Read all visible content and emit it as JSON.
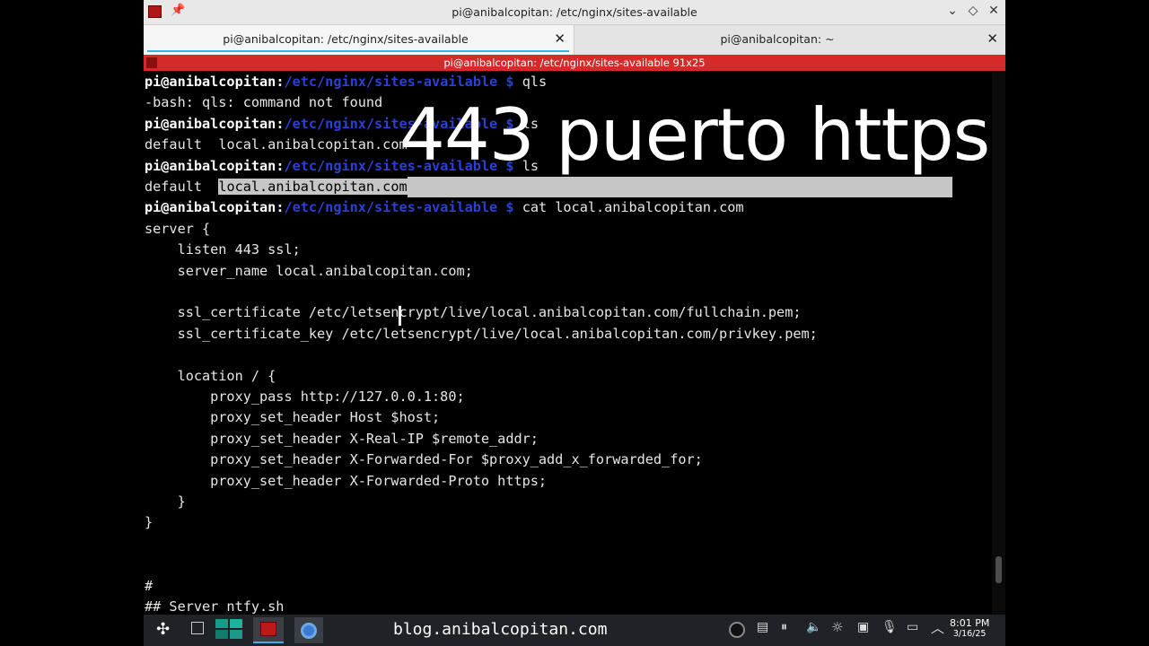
{
  "window": {
    "title": "pi@anibalcopitan: /etc/nginx/sites-available",
    "tabs": [
      {
        "label": "pi@anibalcopitan: /etc/nginx/sites-available",
        "active": true
      },
      {
        "label": "pi@anibalcopitan: ~",
        "active": false
      }
    ],
    "session_title": "pi@anibalcopitan: /etc/nginx/sites-available 91x25"
  },
  "overlay_caption": "443 puerto https",
  "terminal": {
    "user": "pi@anibalcopitan",
    "path": "/etc/nginx/sites-available",
    "prompt_symbol": "$",
    "cmd1": "qls",
    "out1": "-bash: qls: command not found",
    "cmd2": "ls",
    "out2a": "default",
    "out2b": "local.anibalcopitan.com",
    "cmd3": "ls",
    "out3a": "default",
    "out3b": "local.anibalcopitan.com",
    "cmd4": "cat local.anibalcopitan.com",
    "config": [
      "server {",
      "    listen 443 ssl;",
      "    server_name local.anibalcopitan.com;",
      "",
      "    ssl_certificate /etc/letsencrypt/live/local.anibalcopitan.com/fullchain.pem;",
      "    ssl_certificate_key /etc/letsencrypt/live/local.anibalcopitan.com/privkey.pem;",
      "",
      "    location / {",
      "        proxy_pass http://127.0.0.1:80;",
      "        proxy_set_header Host $host;",
      "        proxy_set_header X-Real-IP $remote_addr;",
      "        proxy_set_header X-Forwarded-For $proxy_add_x_forwarded_for;",
      "        proxy_set_header X-Forwarded-Proto https;",
      "    }",
      "}",
      "",
      "",
      "#",
      "## Server ntfy.sh"
    ]
  },
  "taskbar": {
    "url_text": "blog.anibalcopitan.com",
    "clock_time": "8:01 PM",
    "clock_date": "3/16/25"
  },
  "colors": {
    "session_bar": "#d42a2a",
    "prompt_path": "#2c3fd6",
    "selection": "#c6c6c6",
    "tab_accent": "#3daee9"
  }
}
